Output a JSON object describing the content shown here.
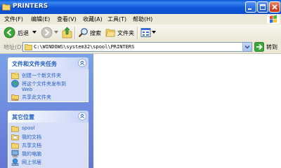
{
  "window": {
    "title": "PRINTERS"
  },
  "menu": {
    "items": [
      "文件(F)",
      "编辑(E)",
      "查看(V)",
      "收藏(A)",
      "工具(T)",
      "帮助(H)"
    ]
  },
  "toolbar": {
    "back_label": "后退",
    "folders_label": "文件夹"
  },
  "address": {
    "label": "地址(D)",
    "value": "C:\\WINDOWS\\system32\\spool\\PRINTERS",
    "go_label": "转到"
  },
  "tasks_panel": {
    "title": "文件和文件夹任务",
    "items": [
      {
        "label": "创建一个新文件夹",
        "icon": "new-folder-icon"
      },
      {
        "label": "将这个文件夹发布到",
        "label2": "Web",
        "icon": "publish-web-icon"
      },
      {
        "label": "共享此文件夹",
        "icon": "share-folder-icon"
      }
    ]
  },
  "places_panel": {
    "title": "其它位置",
    "items": [
      {
        "label": "spool",
        "icon": "folder-icon"
      },
      {
        "label": "我的文档",
        "icon": "my-documents-icon"
      },
      {
        "label": "共享文档",
        "icon": "shared-documents-icon"
      },
      {
        "label": "我的电脑",
        "icon": "my-computer-icon"
      },
      {
        "label": "网上邻居",
        "icon": "network-places-icon"
      }
    ]
  },
  "colors": {
    "titlebar": "#0b4fcc",
    "taskpane": "#6f8fde",
    "link": "#215dc6"
  }
}
